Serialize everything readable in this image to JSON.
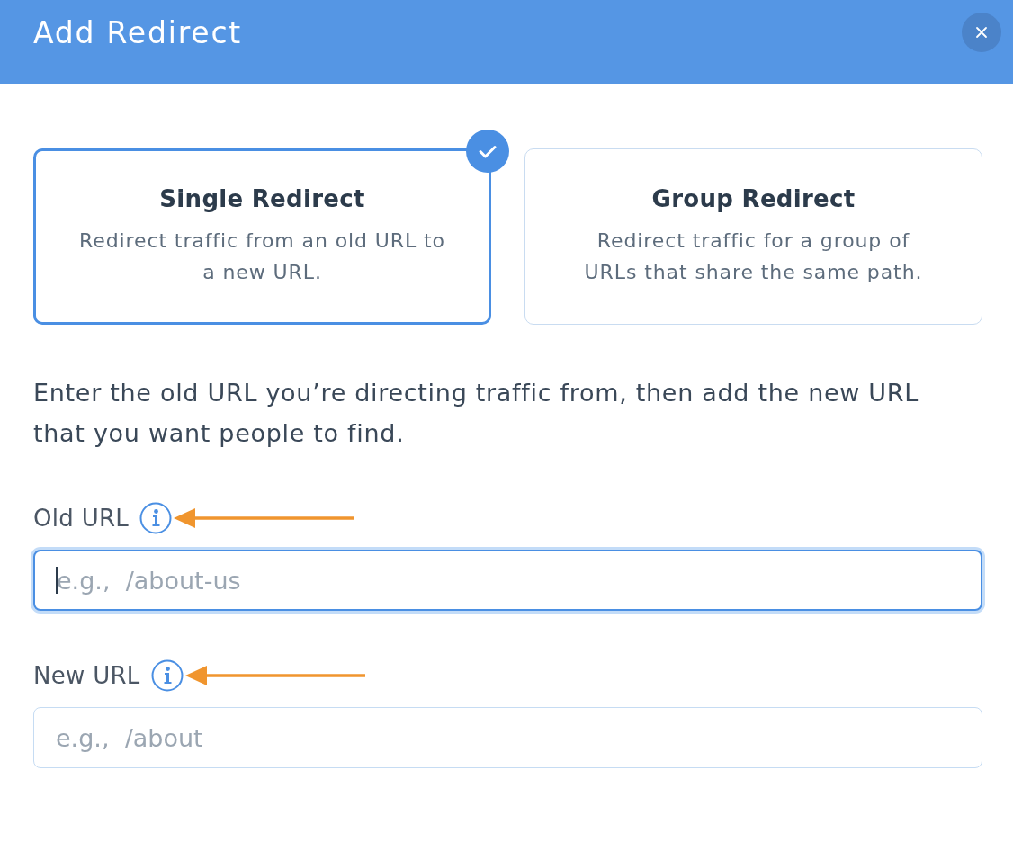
{
  "dialog": {
    "title": "Add Redirect"
  },
  "options": [
    {
      "title": "Single Redirect",
      "description": "Redirect traffic from an old URL to a new URL.",
      "selected": true
    },
    {
      "title": "Group Redirect",
      "description": "Redirect traffic for a group of URLs that share the same path.",
      "selected": false
    }
  ],
  "instructions": "Enter the old URL you’re directing traffic from, then add the new URL that you want people to find.",
  "fields": [
    {
      "label": "Old URL",
      "placeholder": "e.g.,  /about-us",
      "focused": true,
      "annotated": true
    },
    {
      "label": "New URL",
      "placeholder": "e.g.,  /about",
      "focused": false,
      "annotated": true
    }
  ]
}
